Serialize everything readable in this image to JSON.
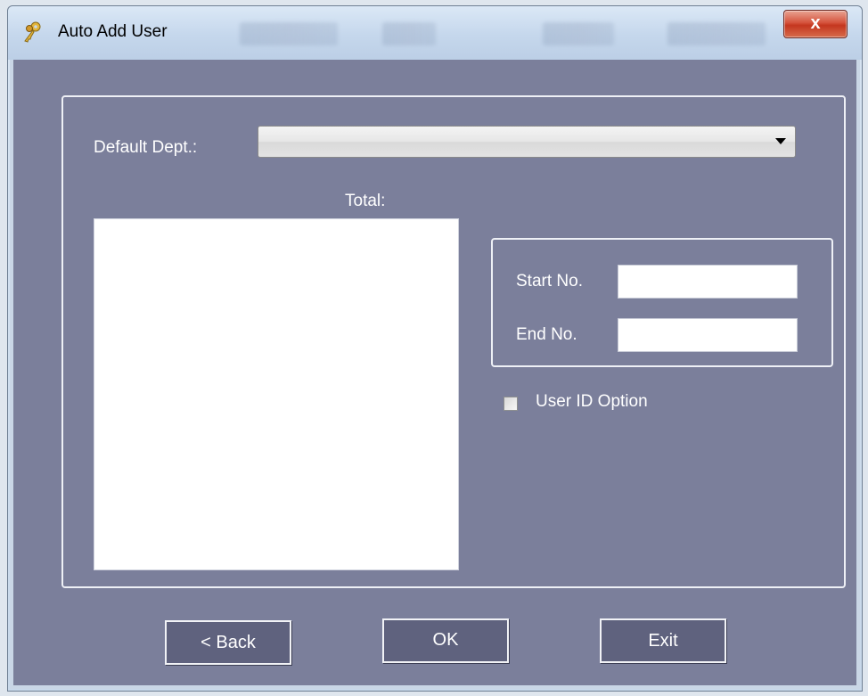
{
  "window": {
    "title": "Auto Add User",
    "close_label": "x"
  },
  "form": {
    "default_dept_label": "Default Dept.:",
    "default_dept_value": "",
    "total_label": "Total:",
    "start_no_label": "Start No.",
    "start_no_value": "",
    "end_no_label": "End No.",
    "end_no_value": "",
    "user_id_option_label": "User ID Option",
    "user_id_option_checked": false
  },
  "buttons": {
    "back_label": "< Back",
    "ok_label": "OK",
    "exit_label": "Exit"
  },
  "icons": {
    "app": "keys-icon",
    "close": "close-icon",
    "dropdown": "chevron-down-icon"
  },
  "colors": {
    "client_background": "#7b7f9b",
    "button_background": "#5f627e",
    "groupbox_border": "#eef0f6",
    "close_button": "#c4361f"
  }
}
